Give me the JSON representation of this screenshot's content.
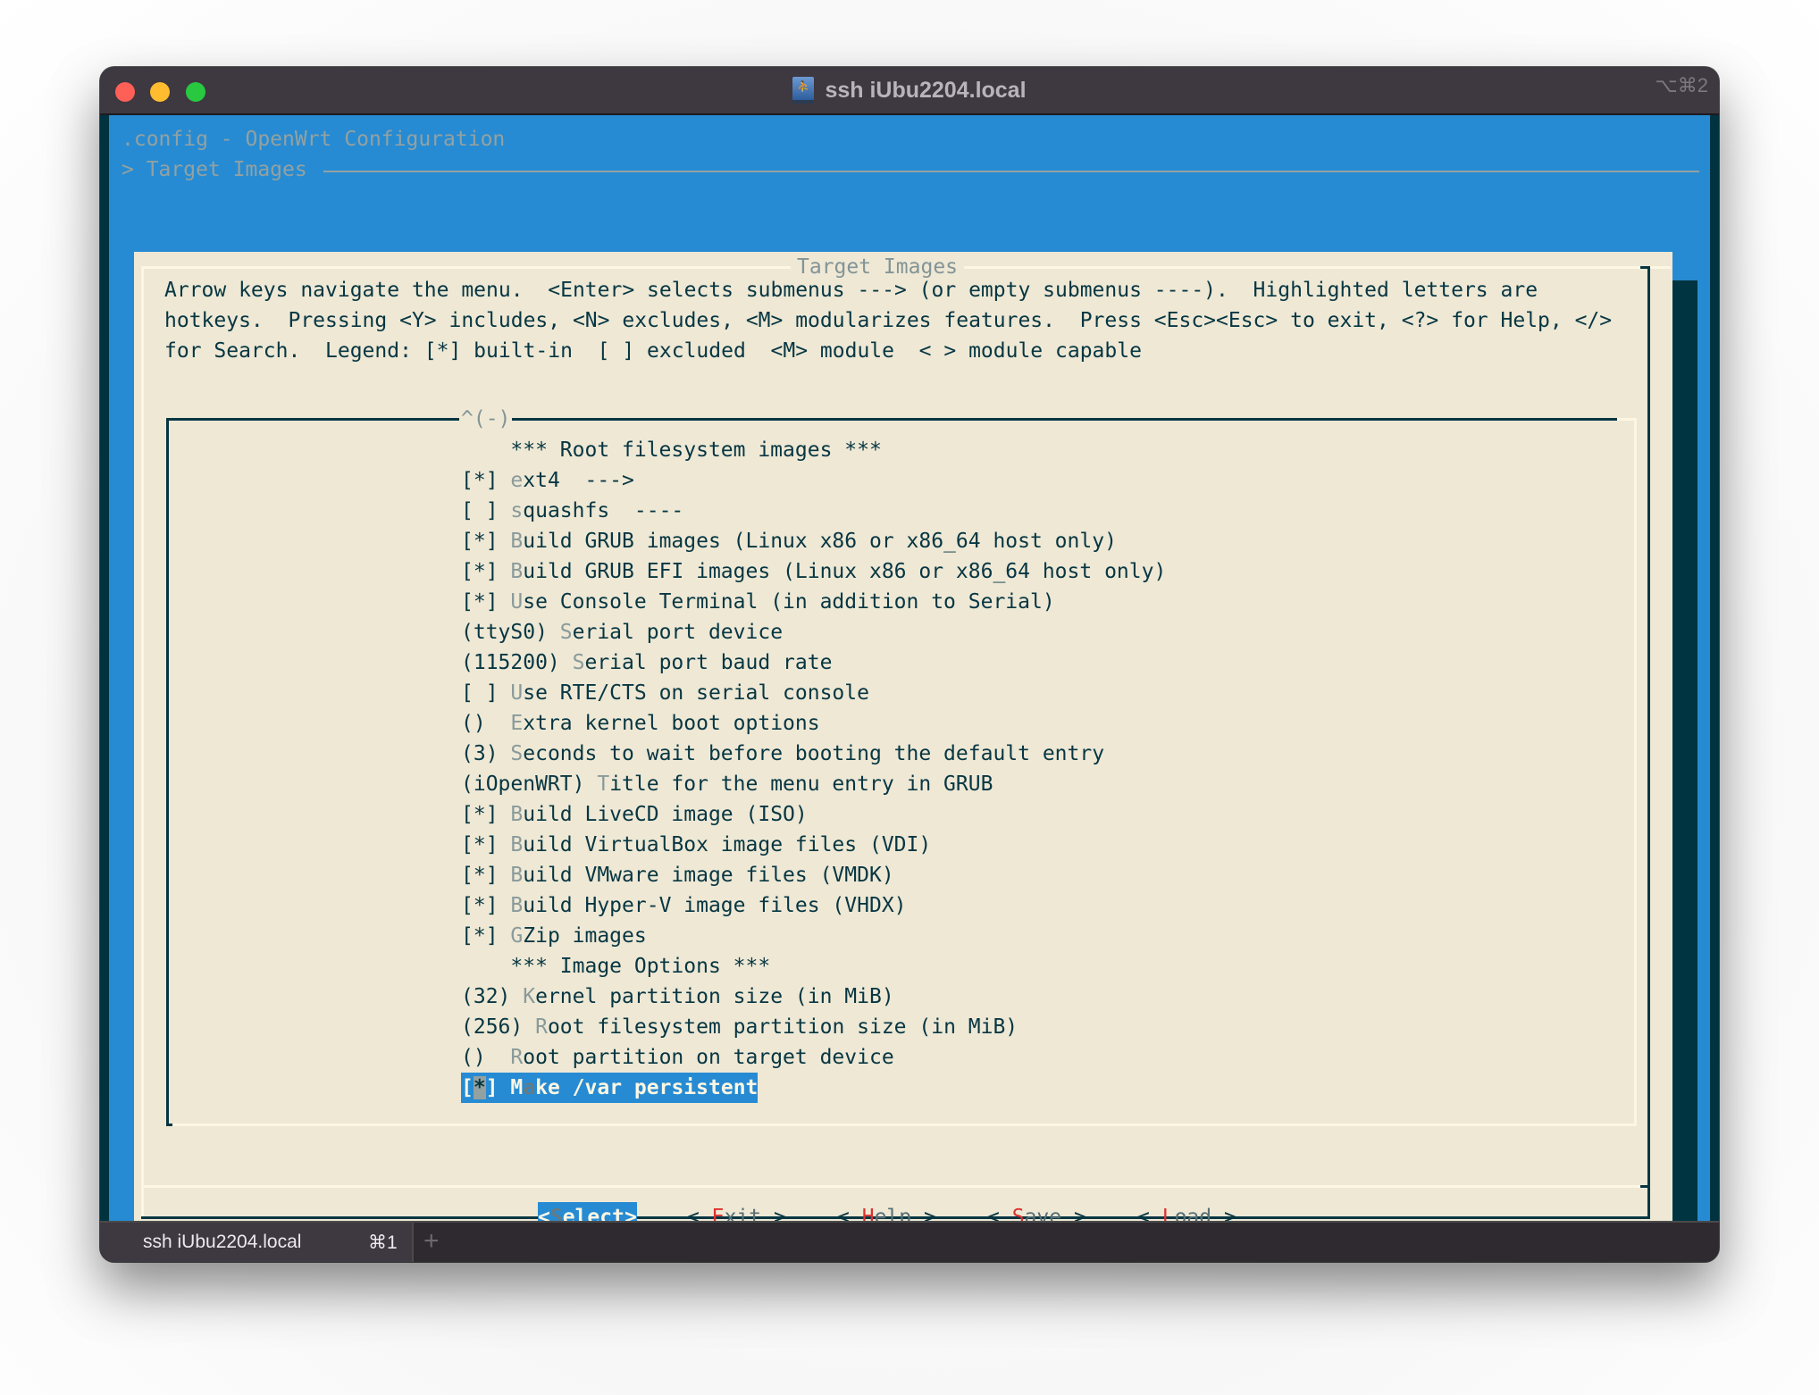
{
  "window": {
    "title": "ssh iUbu2204.local",
    "title_icon": "network-drive-icon",
    "shortcut": "⌥⌘2"
  },
  "terminal": {
    "backtitle": ".config - OpenWrt Configuration",
    "breadcrumb": "> Target Images",
    "dialog": {
      "title": "Target Images",
      "help_lines": [
        "Arrow keys navigate the menu.  <Enter> selects submenus ---> (or empty submenus ----).  Highlighted letters are",
        "hotkeys.  Pressing <Y> includes, <N> excludes, <M> modularizes features.  Press <Esc><Esc> to exit, <?> for Help, </>",
        "for Search.  Legend: [*] built-in  [ ] excluded  <M> module  < > module capable"
      ],
      "scroll_indicator": "^(-)",
      "menu_items": [
        {
          "prefix": "    ",
          "hotkey": "",
          "rest": "*** Root filesystem images ***"
        },
        {
          "prefix": "[*] ",
          "hotkey": "e",
          "rest": "xt4  --->"
        },
        {
          "prefix": "[ ] ",
          "hotkey": "s",
          "rest": "quashfs  ----"
        },
        {
          "prefix": "[*] ",
          "hotkey": "B",
          "rest": "uild GRUB images (Linux x86 or x86_64 host only)"
        },
        {
          "prefix": "[*] ",
          "hotkey": "B",
          "rest": "uild GRUB EFI images (Linux x86 or x86_64 host only)"
        },
        {
          "prefix": "[*] ",
          "hotkey": "U",
          "rest": "se Console Terminal (in addition to Serial)"
        },
        {
          "prefix": "(ttyS0) ",
          "hotkey": "S",
          "rest": "erial port device"
        },
        {
          "prefix": "(115200) ",
          "hotkey": "S",
          "rest": "erial port baud rate"
        },
        {
          "prefix": "[ ] ",
          "hotkey": "U",
          "rest": "se RTE/CTS on serial console"
        },
        {
          "prefix": "()  ",
          "hotkey": "E",
          "rest": "xtra kernel boot options"
        },
        {
          "prefix": "(3) ",
          "hotkey": "S",
          "rest": "econds to wait before booting the default entry"
        },
        {
          "prefix": "(iOpenWRT) ",
          "hotkey": "T",
          "rest": "itle for the menu entry in GRUB"
        },
        {
          "prefix": "[*] ",
          "hotkey": "B",
          "rest": "uild LiveCD image (ISO)"
        },
        {
          "prefix": "[*] ",
          "hotkey": "B",
          "rest": "uild VirtualBox image files (VDI)"
        },
        {
          "prefix": "[*] ",
          "hotkey": "B",
          "rest": "uild VMware image files (VMDK)"
        },
        {
          "prefix": "[*] ",
          "hotkey": "B",
          "rest": "uild Hyper-V image files (VHDX)"
        },
        {
          "prefix": "[*] ",
          "hotkey": "G",
          "rest": "Zip images"
        },
        {
          "prefix": "    ",
          "hotkey": "",
          "rest": "*** Image Options ***"
        },
        {
          "prefix": "(32) ",
          "hotkey": "K",
          "rest": "ernel partition size (in MiB)"
        },
        {
          "prefix": "(256) ",
          "hotkey": "R",
          "rest": "oot filesystem partition size (in MiB)"
        },
        {
          "prefix": "()  ",
          "hotkey": "R",
          "rest": "oot partition on target device"
        }
      ],
      "selected_item": {
        "open": "[",
        "cursor": "*",
        "close": "] ",
        "first": "M",
        "hotkey": "a",
        "rest": "ke /var persistent"
      },
      "buttons": [
        {
          "pre": "<",
          "hotkey": "S",
          "rest": "elect",
          "post": ">",
          "active": true
        },
        {
          "pre": "< ",
          "hotkey": "E",
          "rest": "xit",
          "post": " >",
          "active": false
        },
        {
          "pre": "< ",
          "hotkey": "H",
          "rest": "elp",
          "post": " >",
          "active": false
        },
        {
          "pre": "< ",
          "hotkey": "S",
          "rest": "ave",
          "post": " >",
          "active": false
        },
        {
          "pre": "< ",
          "hotkey": "L",
          "rest": "oad",
          "post": " >",
          "active": false
        }
      ]
    }
  },
  "tabs": [
    {
      "label": "ssh iUbu2204.local",
      "shortcut": "⌘1",
      "active": true
    }
  ],
  "new_tab_icon": "+",
  "colors": {
    "terminal_bg": "#268bd3",
    "dialog_bg": "#eee8d5",
    "shadow": "#003440",
    "text": "#073642",
    "hotkey": "#8a9a9b",
    "button_hotkey": "#dc322f"
  }
}
